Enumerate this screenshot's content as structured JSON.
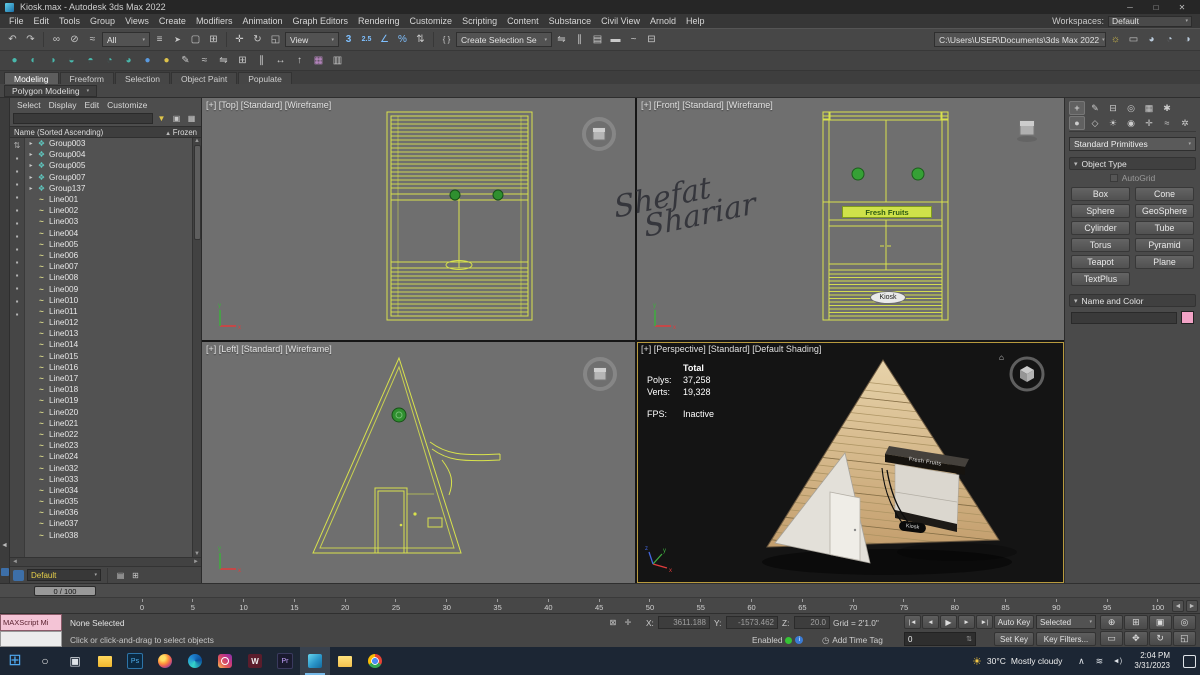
{
  "titlebar": {
    "title": "Kiosk.max - Autodesk 3ds Max 2022"
  },
  "menubar": {
    "items": [
      "File",
      "Edit",
      "Tools",
      "Group",
      "Views",
      "Create",
      "Modifiers",
      "Animation",
      "Graph Editors",
      "Rendering",
      "Customize",
      "Scripting",
      "Content",
      "Substance",
      "Civil View",
      "Arnold",
      "Help"
    ],
    "workspaces_label": "Workspaces:",
    "workspace_value": "Default"
  },
  "toolbar_main": {
    "filter_value": "All",
    "view_value": "View",
    "selection_set_value": "Create Selection Se",
    "path_value": "C:\\Users\\USER\\Documents\\3ds Max 2022",
    "history_icons": [
      "undo-icon",
      "redo-icon"
    ],
    "link_icons": [
      "select-and-link-icon",
      "unlink-selection-icon",
      "bind-to-space-warp-icon"
    ],
    "select_icons": [
      "select-by-name-icon",
      "select-object-icon",
      "rectangular-region-icon",
      "window-crossing-icon"
    ],
    "transform_icons": [
      "select-and-move-icon",
      "select-and-rotate-icon",
      "select-and-scale-icon"
    ],
    "snap_icons": [
      "snap-3-icon",
      "snap-25-icon",
      "angle-snap-icon",
      "percent-snap-icon",
      "spinner-snap-icon"
    ],
    "named_set_icons": [
      "edit-named-selection-sets-icon"
    ],
    "utility_icons": [
      "mirror-icon",
      "align-icon",
      "layer-explorer-icon",
      "ribbon-toggle-icon",
      "curve-editor-icon",
      "schematic-view-icon"
    ],
    "render_icons": [
      "render-setup-icon",
      "rendered-frame-icon",
      "render-production-icon",
      "render-iterative-icon",
      "render-online-icon"
    ]
  },
  "toolbar_secondary": {
    "icons": [
      "edit-poly-icon",
      "swift-loop-icon",
      "paint-connect-icon",
      "chamfer-icon",
      "constraints-icon",
      "soft-selection-icon",
      "paint-deform-icon",
      "material-sphere-blue-icon",
      "material-sphere-yellow-icon",
      "select-brush-icon",
      "relax-icon",
      "mirror-geometry-icon",
      "array-icon",
      "spacing-tool-icon",
      "measure-icon",
      "normals-icon",
      "color-clipboard-icon",
      "channel-info-icon"
    ]
  },
  "ribbon": {
    "tabs": [
      "Modeling",
      "Freeform",
      "Selection",
      "Object Paint",
      "Populate"
    ],
    "subtab": "Polygon Modeling"
  },
  "explorer": {
    "menu": [
      "Select",
      "Display",
      "Edit",
      "Customize"
    ],
    "search_icons": [
      "filter-icon",
      "lock-icon",
      "columns-icon"
    ],
    "header_name": "Name (Sorted Ascending)",
    "header_frozen": "Frozen",
    "strip_icons": [
      "sort-icon",
      "display-none-icon",
      "display-geometry-icon",
      "display-shapes-icon",
      "display-lights-icon",
      "display-cameras-icon",
      "display-helpers-icon",
      "display-space-warps-icon",
      "display-groups-icon",
      "display-bones-icon",
      "display-containers-icon",
      "display-materials-icon",
      "display-frozen-icon",
      "display-hidden-icon"
    ],
    "groups": [
      "Group003",
      "Group004",
      "Group005",
      "Group007",
      "Group137"
    ],
    "lines": [
      "Line001",
      "Line002",
      "Line003",
      "Line004",
      "Line005",
      "Line006",
      "Line007",
      "Line008",
      "Line009",
      "Line010",
      "Line011",
      "Line012",
      "Line013",
      "Line014",
      "Line015",
      "Line016",
      "Line017",
      "Line018",
      "Line019",
      "Line020",
      "Line021",
      "Line022",
      "Line023",
      "Line024",
      "Line032",
      "Line033",
      "Line034",
      "Line035",
      "Line036",
      "Line037",
      "Line038"
    ],
    "footer_value": "Default",
    "footer_icons": [
      "show-influences-icon",
      "configure-columns-icon"
    ]
  },
  "viewports": {
    "top": {
      "label": "[+] [Top] [Standard] [Wireframe]"
    },
    "front": {
      "label": "[+] [Front] [Standard] [Wireframe]",
      "sign": "Fresh Fruits",
      "plate": "Kiosk"
    },
    "left": {
      "label": "[+] [Left] [Standard] [Wireframe]"
    },
    "perspective": {
      "label": "[+] [Perspective] [Standard] [Default Shading]",
      "sign": "Fresh Fruits",
      "plate": "Kiosk",
      "stats": {
        "total_label": "Total",
        "polys_label": "Polys:",
        "polys_value": "37,258",
        "verts_label": "Verts:",
        "verts_value": "19,328",
        "fps_label": "FPS:",
        "fps_value": "Inactive"
      }
    },
    "watermark": {
      "line1": "Shefat",
      "line2": "Shariar"
    }
  },
  "command_panel": {
    "tab_icons": [
      "create-tab-icon",
      "modify-tab-icon",
      "hierarchy-tab-icon",
      "motion-tab-icon",
      "display-tab-icon",
      "utilities-tab-icon"
    ],
    "category_icons": [
      "geometry-icon",
      "shapes-icon",
      "lights-icon",
      "cameras-icon",
      "helpers-icon",
      "space-warps-icon",
      "systems-icon"
    ],
    "primitive_dropdown": "Standard Primitives",
    "rollout_object_type": "Object Type",
    "autogrid_label": "AutoGrid",
    "buttons": [
      "Box",
      "Cone",
      "Sphere",
      "GeoSphere",
      "Cylinder",
      "Tube",
      "Torus",
      "Pyramid",
      "Teapot",
      "Plane",
      "TextPlus"
    ],
    "rollout_name_color": "Name and Color",
    "swatch_color": "#f2a3c6"
  },
  "timeline": {
    "slider_value": "0 / 100",
    "ticks": [
      "0",
      "5",
      "10",
      "15",
      "20",
      "25",
      "30",
      "35",
      "40",
      "45",
      "50",
      "55",
      "60",
      "65",
      "70",
      "75",
      "80",
      "85",
      "90",
      "95",
      "100"
    ]
  },
  "statusbar": {
    "listener_text": "MAXScript Mi",
    "status_text": "None Selected",
    "prompt_text": "Click or click-and-drag to select objects",
    "mode_icons": [
      "selection-lock-icon",
      "absolute-mode-icon"
    ],
    "x_label": "X:",
    "x_value": "3611.188",
    "y_label": "Y:",
    "y_value": "-1573.462",
    "z_label": "Z:",
    "z_value": "20.0",
    "grid_text": "Grid = 2'1.0\"",
    "playback_icons": [
      "go-to-start-icon",
      "previous-frame-icon",
      "play-icon",
      "next-frame-icon",
      "go-to-end-icon"
    ],
    "auto_key_label": "Auto Key",
    "selected_value": "Selected",
    "set_key_label": "Set Key",
    "key_filters_label": "Key Filters...",
    "frame_value": "0",
    "enabled_label": "Enabled",
    "add_time_tag_label": "Add Time Tag",
    "nav_icons": [
      "zoom-icon",
      "zoom-all-icon",
      "zoom-extents-icon",
      "zoom-extents-all-icon",
      "zoom-region-icon",
      "pan-icon",
      "orbit-icon",
      "maximize-viewport-icon"
    ]
  },
  "taskbar": {
    "apps": [
      "start-button",
      "search-icon",
      "task-view-icon",
      "file-explorer-icon",
      "photoshop-icon",
      "firefox-icon",
      "edge-icon",
      "instagram-icon",
      "wondershare-icon",
      "premiere-icon",
      "3ds-max-icon",
      "folder-icon",
      "chrome-icon"
    ],
    "weather_temp": "30°C",
    "weather_desc": "Mostly cloudy",
    "tray_icons": [
      "tray-chevron-icon",
      "network-icon",
      "volume-icon"
    ],
    "time": "2:04 PM",
    "date": "3/31/2023"
  }
}
